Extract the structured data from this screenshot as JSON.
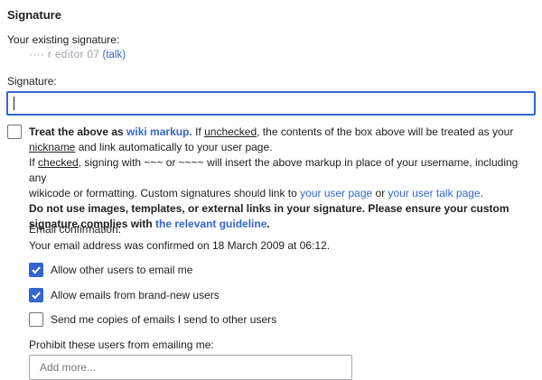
{
  "signature_section": {
    "title": "Signature",
    "existing_label": "Your existing signature:",
    "existing_value_obscured": "···· r editor 07",
    "existing_talk_link": "(talk)",
    "signature_label": "Signature:",
    "signature_value": "",
    "wiki_markup_option": {
      "checked": false,
      "line1_bold_prefix": "Treat the above as ",
      "line1_link": "wiki markup.",
      "line1_mid": " If ",
      "line1_underlined": "unchecked",
      "line1_rest": ", the contents of the box above will be treated as your",
      "line2_underlined": "nickname",
      "line2_rest": " and link automatically to your user page.",
      "line3_prefix": "If ",
      "line3_underlined": "checked",
      "line3_rest": ", signing with ~~~ or ~~~~ will insert the above markup in place of your username, including any",
      "line4_prefix": "wikicode or formatting. Custom signatures should link to ",
      "line4_link1": "your user page",
      "line4_mid": " or ",
      "line4_link2": "your user talk page",
      "line4_end": ".",
      "line5_bold": "Do not use images, templates, or external links in your signature. Please ensure your custom",
      "line6_bold": "signature complies with ",
      "line6_link": "the relevant guideline",
      "line6_end": "."
    }
  },
  "email_section": {
    "confirmation_label": "Email confirmation:",
    "confirmation_text": "Your email address was confirmed on 18 March 2009 at 06:12.",
    "options": [
      {
        "label": "Allow other users to email me",
        "checked": true
      },
      {
        "label": "Allow emails from brand-new users",
        "checked": true
      },
      {
        "label": "Send me copies of emails I send to other users",
        "checked": false
      }
    ],
    "prohibit_label": "Prohibit these users from emailing me:",
    "prohibit_placeholder": "Add more..."
  },
  "colors": {
    "accent": "#3366cc",
    "text": "#202122",
    "border": "#72777d"
  }
}
